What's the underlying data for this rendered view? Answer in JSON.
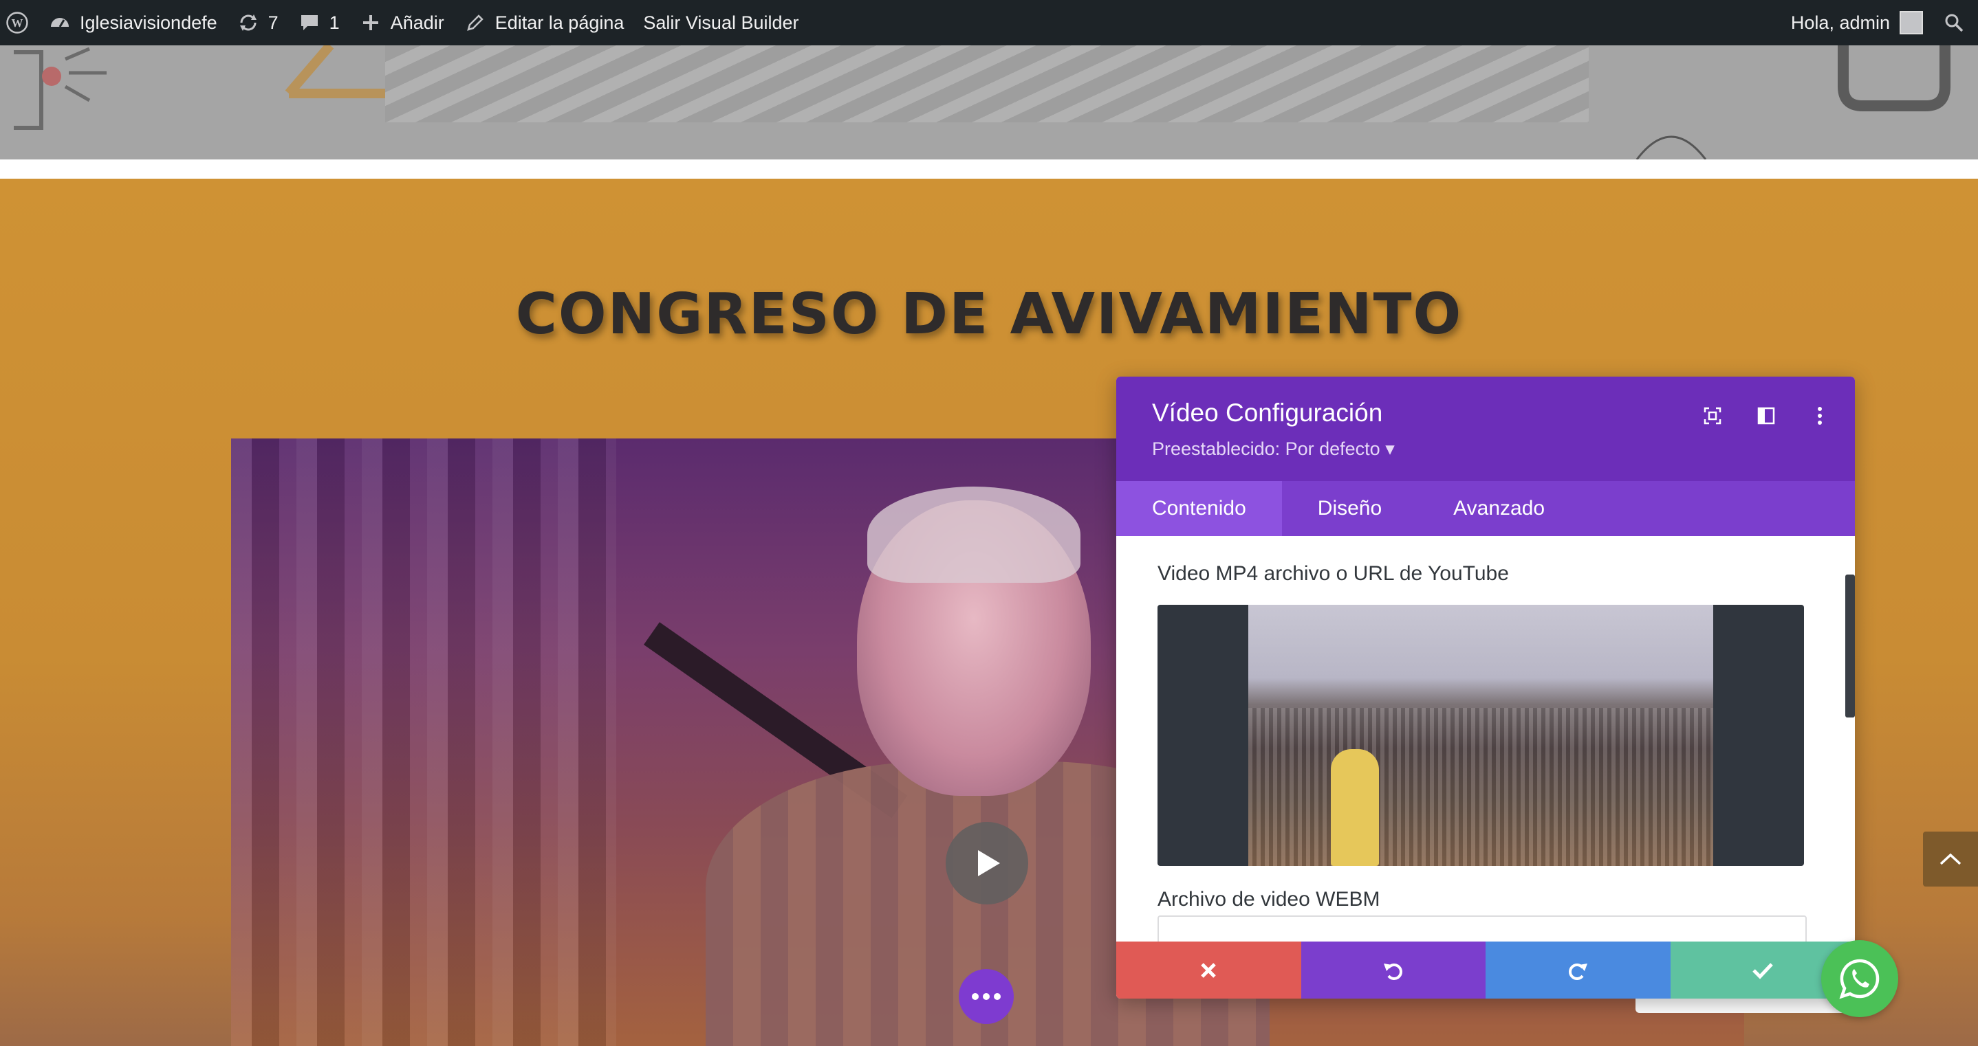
{
  "adminbar": {
    "site_name": "Iglesiavisiondefe",
    "updates_count": "7",
    "comments_count": "1",
    "add_label": "Añadir",
    "edit_page_label": "Editar la página",
    "exit_builder_label": "Salir Visual Builder",
    "greeting": "Hola, admin"
  },
  "hero": {
    "headline": "CONGRESO DE AVIVAMIENTO"
  },
  "panel": {
    "title": "Vídeo Configuración",
    "preset": "Preestablecido: Por defecto ▾",
    "tabs": [
      {
        "label": "Contenido",
        "active": true
      },
      {
        "label": "Diseño",
        "active": false
      },
      {
        "label": "Avanzado",
        "active": false
      }
    ],
    "fields": {
      "mp4_label": "Video MP4 archivo o URL de YouTube",
      "webm_label": "Archivo de video WEBM"
    }
  },
  "colors": {
    "panel_header": "#6c2eb9",
    "tab_bar": "#7b3ecd",
    "section_bg": "#cf9234",
    "cancel": "#e05a55",
    "undo": "#7b3ecd",
    "redo": "#4a8ae0",
    "save": "#5fc2a0",
    "whatsapp": "#4bc157"
  },
  "icons": {
    "wordpress": "wordpress-icon",
    "dashboard": "dashboard-icon",
    "updates": "refresh-icon",
    "comments": "comment-icon",
    "add": "plus-icon",
    "edit": "pencil-icon",
    "search": "search-icon",
    "fullscreen": "expand-icon",
    "layout": "sidebar-layout-icon",
    "menu": "kebab-icon",
    "play": "play-icon",
    "more": "ellipsis-icon",
    "cancel": "close-icon",
    "undo": "undo-icon",
    "redo": "redo-icon",
    "save": "check-icon",
    "scroll_top": "chevron-up-icon",
    "whatsapp": "whatsapp-icon"
  }
}
